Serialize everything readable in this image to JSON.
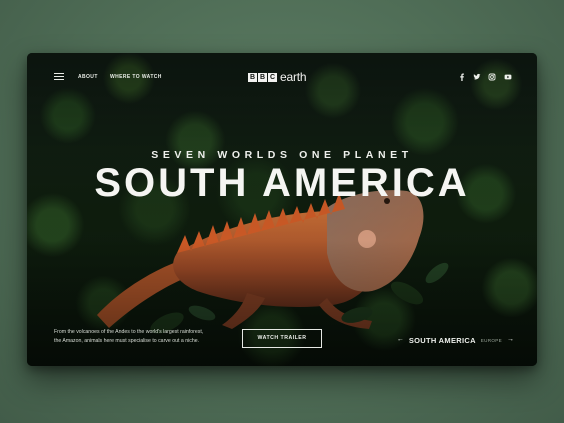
{
  "nav": {
    "about": "ABOUT",
    "where_to_watch": "WHERE TO WATCH"
  },
  "logo": {
    "letters": [
      "B",
      "B",
      "C"
    ],
    "word": "earth"
  },
  "social": [
    "facebook-icon",
    "twitter-icon",
    "instagram-icon",
    "youtube-icon"
  ],
  "hero": {
    "kicker": "SEVEN WORLDS ONE PLANET",
    "title": "SOUTH AMERICA",
    "description_line1": "From the volcanoes of the Andes to the world's largest rainforest,",
    "description_line2": "the Amazon, animals here must specialise to carve out a niche.",
    "cta": "WATCH TRAILER"
  },
  "pager": {
    "prev_arrow": "←",
    "current": "SOUTH AMERICA",
    "next": "EUROPE",
    "next_arrow": "→"
  },
  "colors": {
    "background": "#4f6d56",
    "frame": "#0d150f",
    "iguana_orange": "#c8622c",
    "text": "#f5f5f2"
  }
}
